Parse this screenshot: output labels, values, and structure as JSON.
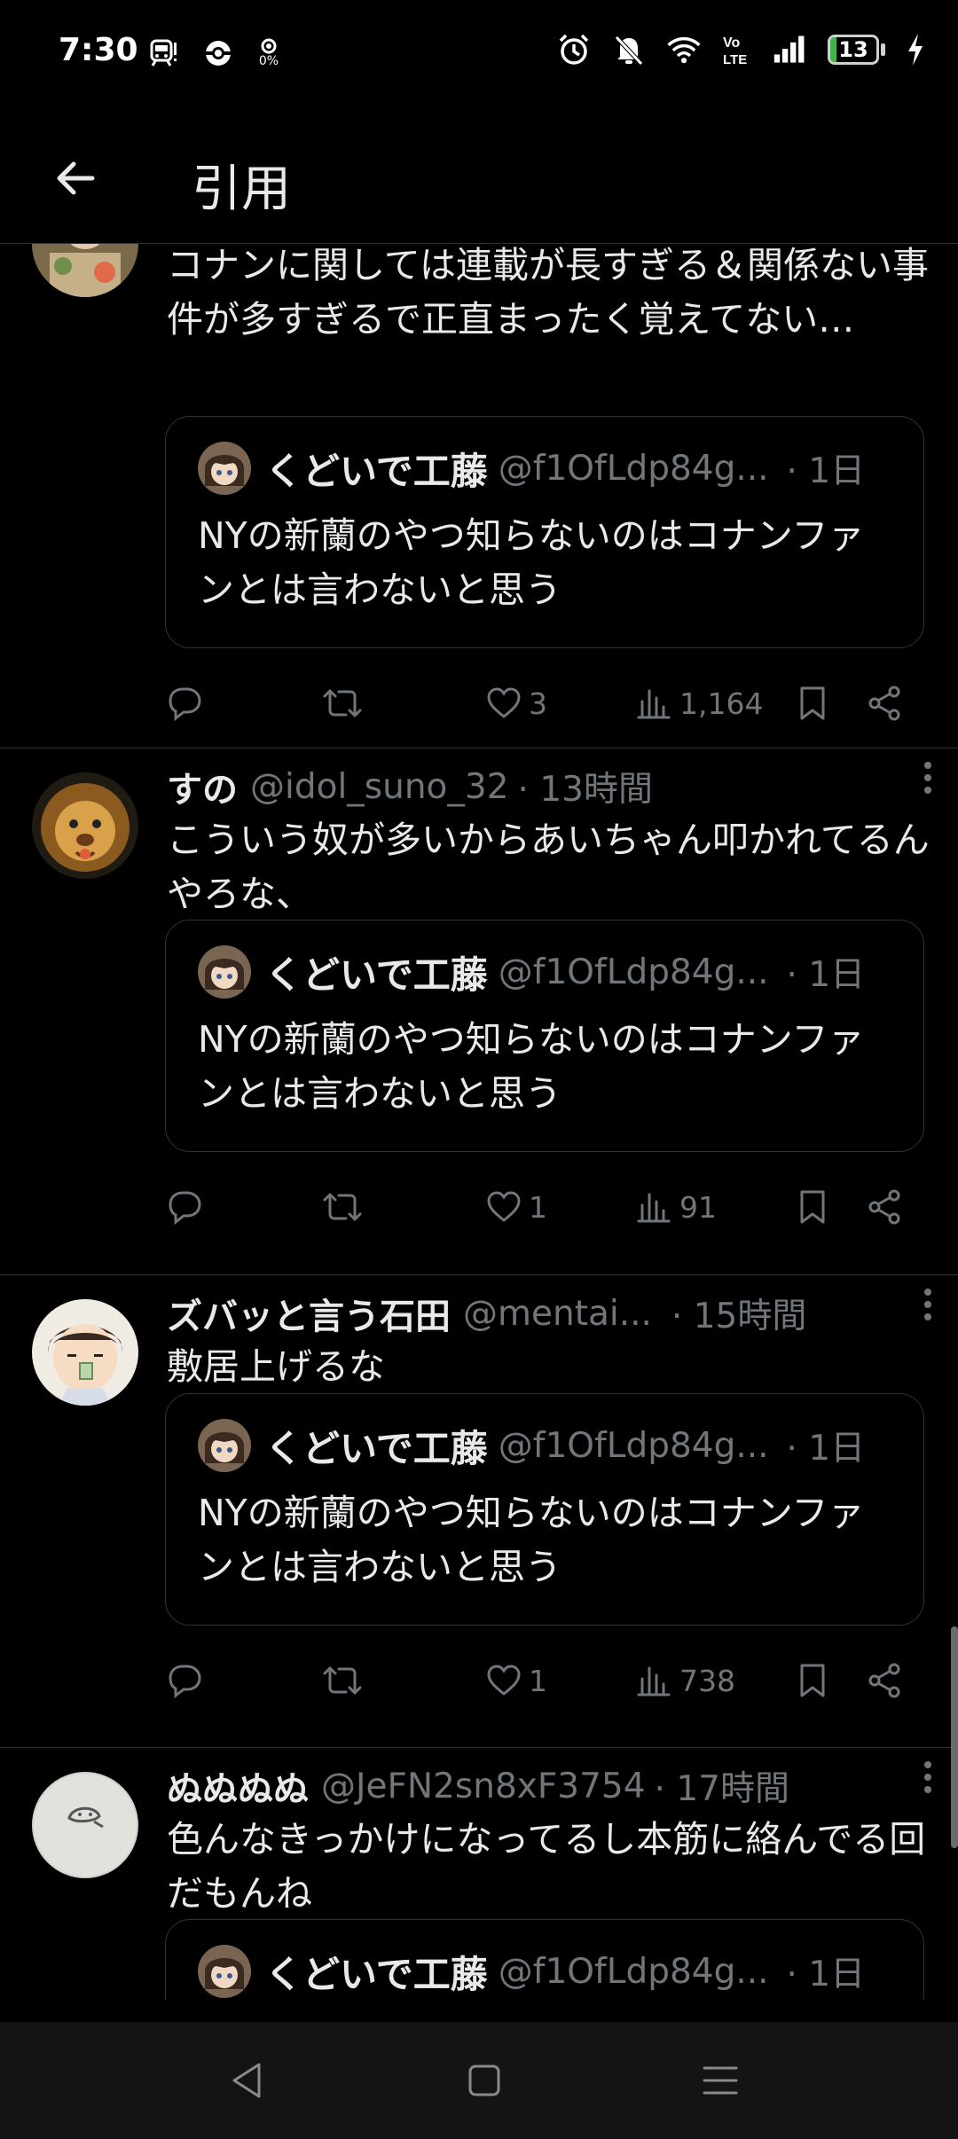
{
  "status_bar": {
    "time": "7:30",
    "left_icons": [
      "train-notification-icon",
      "sync-icon",
      "data-saver-icon"
    ],
    "data_saver_label": "0%",
    "right_icons": [
      "alarm-icon",
      "mute-icon",
      "wifi-icon",
      "volte-icon",
      "signal-icon",
      "battery-icon",
      "charging-icon"
    ],
    "volte_label": "Vo LTE",
    "battery_level": "13",
    "battery_fraction": 0.13,
    "battery_color": "#3fb64a"
  },
  "header": {
    "title": "引用"
  },
  "tweets": [
    {
      "name": "",
      "handle": "",
      "time": "",
      "text": "コナンに関しては連載が長すぎる＆関係ない事件が多すぎるで正直まったく覚えてない…",
      "quote": {
        "name": "くどいで工藤",
        "handle": "@f1OfLdp84g...",
        "time": "· 1日",
        "text": "NYの新蘭のやつ知らないのはコナンファンとは言わないと思う"
      },
      "likes": "3",
      "views": "1,164"
    },
    {
      "name": "すの",
      "handle": "@idol_suno_32",
      "time": "· 13時間",
      "text": "こういう奴が多いからあいちゃん叩かれてるんやろな、",
      "quote": {
        "name": "くどいで工藤",
        "handle": "@f1OfLdp84g...",
        "time": "· 1日",
        "text": "NYの新蘭のやつ知らないのはコナンファンとは言わないと思う"
      },
      "likes": "1",
      "views": "91"
    },
    {
      "name": "ズバッと言う石田",
      "handle": "@mentai...",
      "time": "· 15時間",
      "text": "敷居上げるな",
      "quote": {
        "name": "くどいで工藤",
        "handle": "@f1OfLdp84g...",
        "time": "· 1日",
        "text": "NYの新蘭のやつ知らないのはコナンファンとは言わないと思う"
      },
      "likes": "1",
      "views": "738"
    },
    {
      "name": "ぬぬぬぬ",
      "handle": "@JeFN2sn8xF3754",
      "time": "· 17時間",
      "text": "色んなきっかけになってるし本筋に絡んでる回だもんね",
      "quote": {
        "name": "くどいで工藤",
        "handle": "@f1OfLdp84g...",
        "time": "· 1日",
        "text": ""
      }
    }
  ],
  "colors": {
    "background": "#000000",
    "text": "#e7e9ea",
    "muted": "#71767b",
    "divider": "#2f3336"
  },
  "nav_bar": {
    "buttons": [
      "back-triangle-icon",
      "home-square-icon",
      "menu-lines-icon"
    ]
  }
}
